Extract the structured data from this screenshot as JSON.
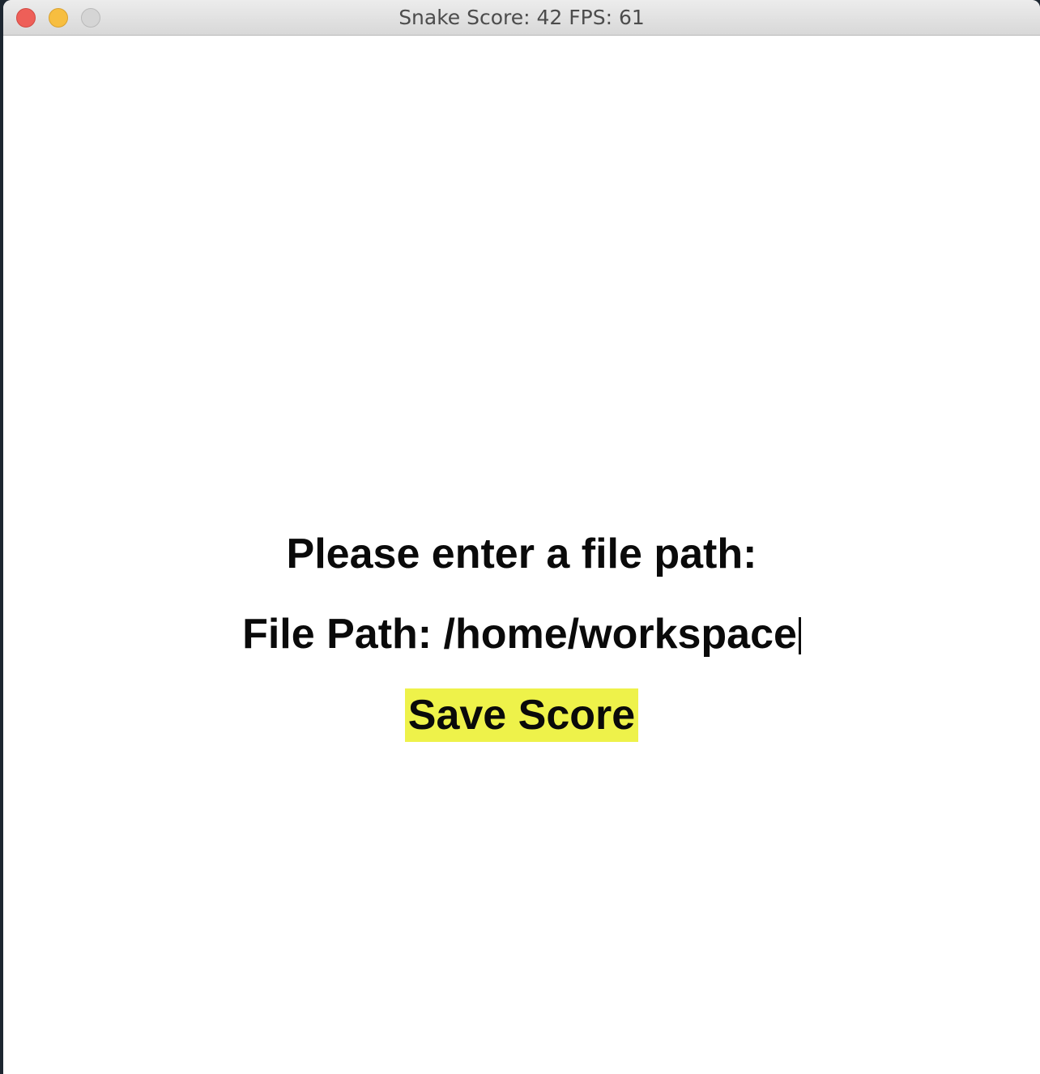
{
  "window": {
    "title": "Snake Score: 42 FPS: 61"
  },
  "dialog": {
    "prompt": "Please enter a file path:",
    "field_label": "File Path: ",
    "field_value": "/home/workspace",
    "save_label": "Save Score"
  },
  "colors": {
    "save_button_bg": "#eef24a",
    "text": "#0a0a0a",
    "background": "#ffffff"
  }
}
